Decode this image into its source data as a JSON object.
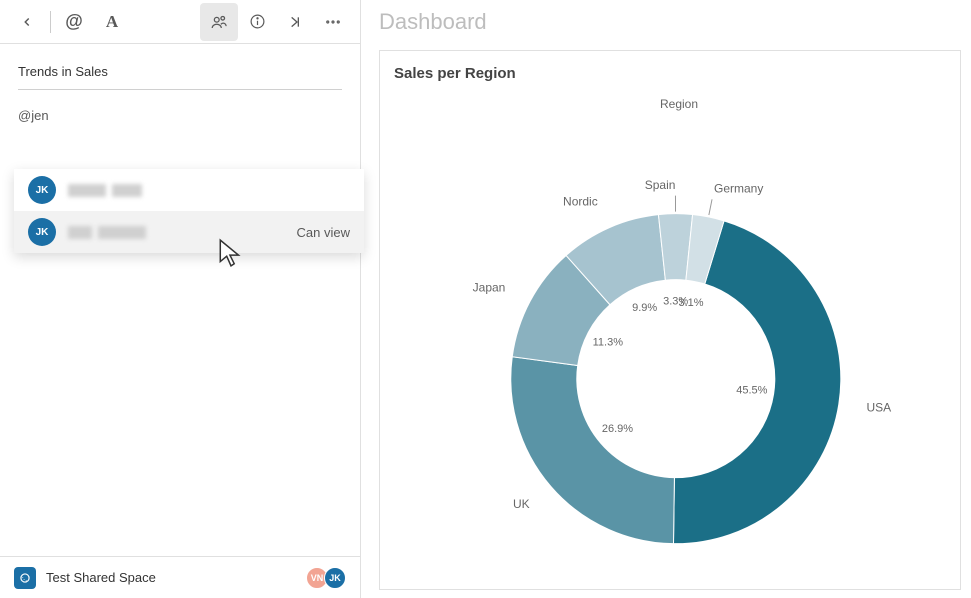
{
  "sidebar": {
    "section_title": "Trends in Sales",
    "mention_text": "@jen",
    "suggestions": [
      {
        "initials": "JK",
        "permission": ""
      },
      {
        "initials": "JK",
        "permission": "Can view"
      }
    ]
  },
  "footer": {
    "space_name": "Test Shared Space",
    "avatars": [
      {
        "initials": "VN",
        "color_class": "av-vn"
      },
      {
        "initials": "JK",
        "color_class": "av-jk"
      }
    ]
  },
  "dashboard": {
    "title": "Dashboard",
    "chart_title": "Sales per Region",
    "legend_title": "Region"
  },
  "chart_data": {
    "type": "pie",
    "title": "Sales per Region",
    "inner_radius_pct": 60,
    "series": [
      {
        "name": "USA",
        "value": 45.5,
        "color": "#1b6f87"
      },
      {
        "name": "UK",
        "value": 26.9,
        "color": "#5a94a6"
      },
      {
        "name": "Japan",
        "value": 11.3,
        "color": "#8ab1bf"
      },
      {
        "name": "Nordic",
        "value": 9.9,
        "color": "#a6c3cf"
      },
      {
        "name": "Spain",
        "value": 3.3,
        "color": "#bdd2db"
      },
      {
        "name": "Germany",
        "value": 3.1,
        "color": "#d2e0e6"
      }
    ]
  }
}
